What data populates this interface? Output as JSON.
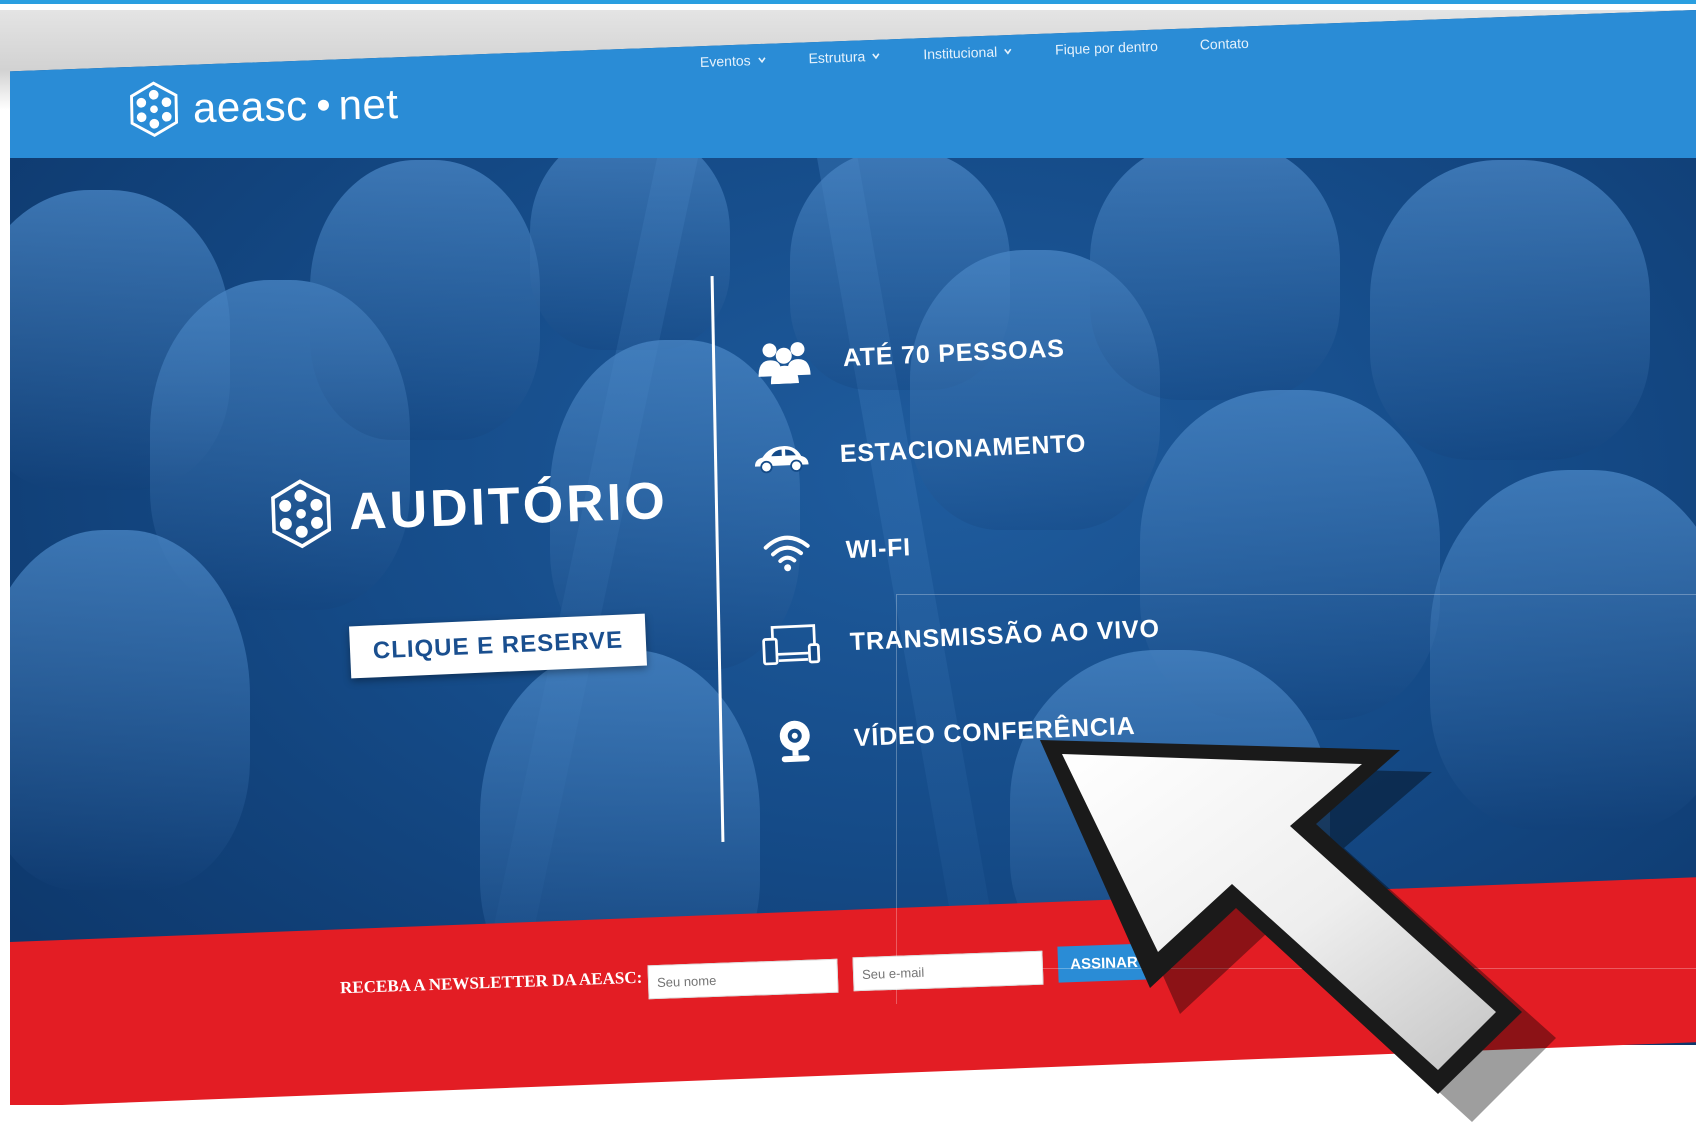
{
  "logo": {
    "part1": "aeasc",
    "part2": "net",
    "icon": "aeasc-logo-icon"
  },
  "nav": {
    "items": [
      {
        "label": "Eventos",
        "dropdown": true
      },
      {
        "label": "Estrutura",
        "dropdown": true
      },
      {
        "label": "Institucional",
        "dropdown": true
      },
      {
        "label": "Fique por dentro",
        "dropdown": false
      },
      {
        "label": "Contato",
        "dropdown": false
      }
    ]
  },
  "hero": {
    "title": "AUDITÓRIO",
    "cta_label": "CLIQUE E RESERVE"
  },
  "features": [
    {
      "label": "ATÉ 70 PESSOAS",
      "icon": "people-icon"
    },
    {
      "label": "ESTACIONAMENTO",
      "icon": "car-icon"
    },
    {
      "label": "WI-FI",
      "icon": "wifi-icon"
    },
    {
      "label": "TRANSMISSÃO AO VIVO",
      "icon": "devices-icon"
    },
    {
      "label": "VÍDEO CONFERÊNCIA",
      "icon": "webcam-icon"
    }
  ],
  "newsletter": {
    "label": "RECEBA A NEWSLETTER DA AEASC:",
    "name_placeholder": "Seu nome",
    "email_placeholder": "Seu e-mail",
    "button_label": "ASSINAR"
  },
  "colors": {
    "nav": "#2a8cd6",
    "hero": "#154b88",
    "newsletter": "#e31d24",
    "button": "#2a8cd6",
    "cta_text": "#1a4f8f"
  }
}
